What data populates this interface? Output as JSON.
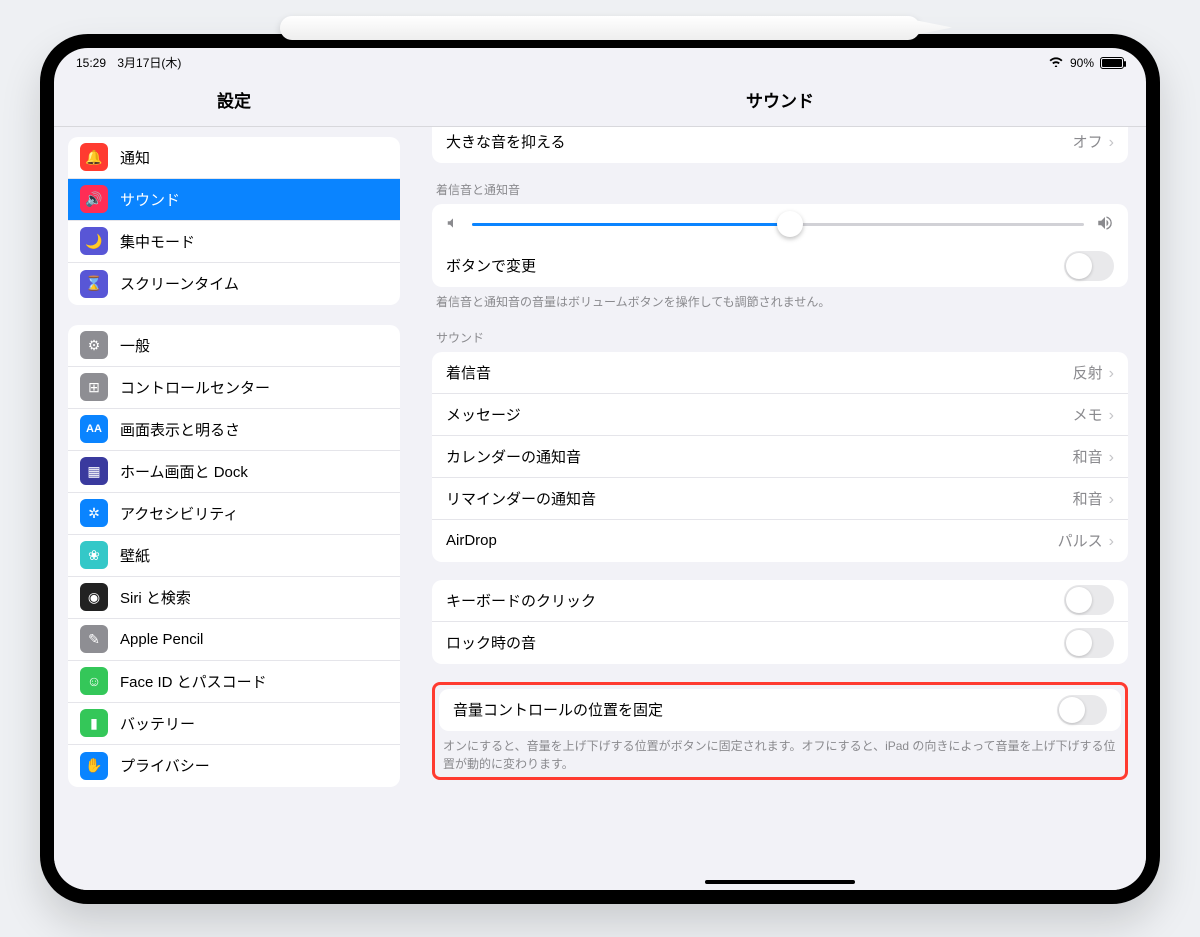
{
  "status": {
    "time": "15:29",
    "date": "3月17日(木)",
    "battery_pct": "90%",
    "battery_fill": 90
  },
  "nav": {
    "left_title": "設定",
    "right_title": "サウンド"
  },
  "sidebar": {
    "group1": [
      {
        "icon": "🔔",
        "bg": "#ff3b30",
        "label": "通知"
      },
      {
        "icon": "🔊",
        "bg": "#ff2d55",
        "label": "サウンド",
        "selected": true
      },
      {
        "icon": "🌙",
        "bg": "#5856d6",
        "label": "集中モード"
      },
      {
        "icon": "⌛",
        "bg": "#5856d6",
        "label": "スクリーンタイム"
      }
    ],
    "group2": [
      {
        "icon": "⚙",
        "bg": "#8e8e93",
        "label": "一般"
      },
      {
        "icon": "⊞",
        "bg": "#8e8e93",
        "label": "コントロールセンター"
      },
      {
        "icon": "AA",
        "bg": "#0a84ff",
        "label": "画面表示と明るさ"
      },
      {
        "icon": "▦",
        "bg": "#3a3a9e",
        "label": "ホーム画面と Dock"
      },
      {
        "icon": "✲",
        "bg": "#0a84ff",
        "label": "アクセシビリティ"
      },
      {
        "icon": "❀",
        "bg": "#34c8c8",
        "label": "壁紙"
      },
      {
        "icon": "◉",
        "bg": "#222",
        "label": "Siri と検索"
      },
      {
        "icon": "✎",
        "bg": "#8e8e93",
        "label": "Apple Pencil"
      },
      {
        "icon": "☺",
        "bg": "#34c759",
        "label": "Face ID とパスコード"
      },
      {
        "icon": "▮",
        "bg": "#34c759",
        "label": "バッテリー"
      },
      {
        "icon": "✋",
        "bg": "#0a84ff",
        "label": "プライバシー"
      }
    ]
  },
  "main": {
    "partial_row": {
      "label": "大きな音を抑える",
      "value": "オフ"
    },
    "ringer_header": "着信音と通知音",
    "slider_pct": 52,
    "button_change": "ボタンで変更",
    "ringer_footer": "着信音と通知音の音量はボリュームボタンを操作しても調節されません。",
    "sound_header": "サウンド",
    "sounds": [
      {
        "label": "着信音",
        "value": "反射"
      },
      {
        "label": "メッセージ",
        "value": "メモ"
      },
      {
        "label": "カレンダーの通知音",
        "value": "和音"
      },
      {
        "label": "リマインダーの通知音",
        "value": "和音"
      },
      {
        "label": "AirDrop",
        "value": "パルス"
      }
    ],
    "toggles2": [
      {
        "label": "キーボードのクリック"
      },
      {
        "label": "ロック時の音"
      }
    ],
    "fixed_pos": {
      "label": "音量コントロールの位置を固定"
    },
    "fixed_footer": "オンにすると、音量を上げ下げする位置がボタンに固定されます。オフにすると、iPad の向きによって音量を上げ下げする位置が動的に変わります。"
  }
}
